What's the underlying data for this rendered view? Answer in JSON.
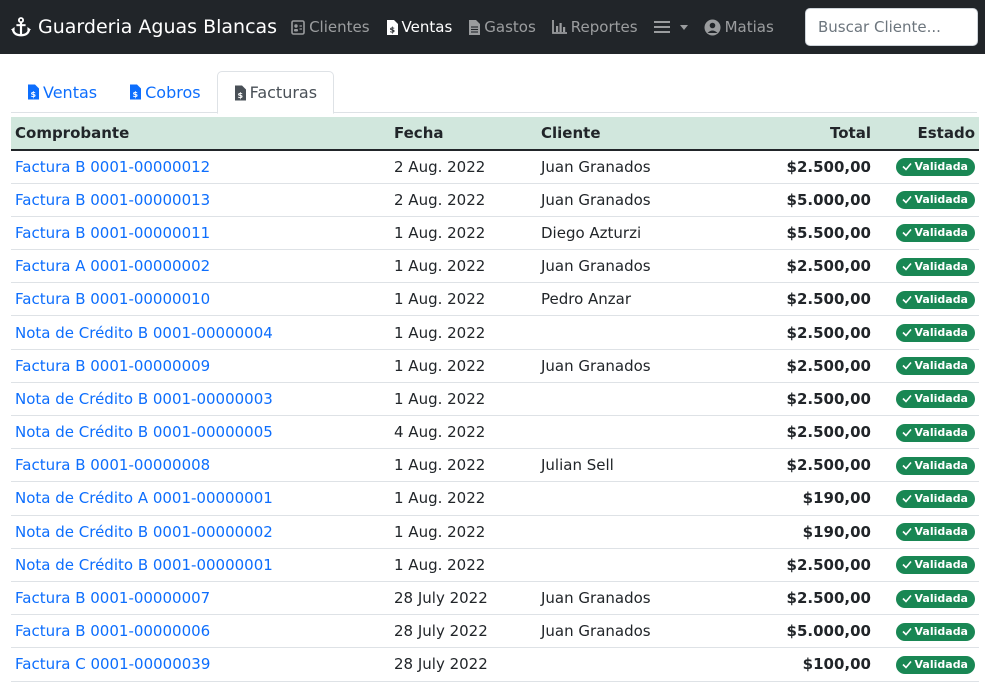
{
  "navbar": {
    "brand": "Guarderia Aguas Blancas",
    "items": [
      {
        "label": "Clientes"
      },
      {
        "label": "Ventas"
      },
      {
        "label": "Gastos"
      },
      {
        "label": "Reportes"
      }
    ],
    "user": "Matias",
    "search_placeholder": "Buscar Cliente..."
  },
  "tabs": [
    {
      "label": "Ventas"
    },
    {
      "label": "Cobros"
    },
    {
      "label": "Facturas"
    }
  ],
  "table": {
    "headers": {
      "comprobante": "Comprobante",
      "fecha": "Fecha",
      "cliente": "Cliente",
      "total": "Total",
      "estado": "Estado"
    },
    "rows": [
      {
        "comprobante": "Factura B 0001-00000012",
        "fecha": "2 Aug. 2022",
        "cliente": "Juan Granados",
        "total": "$2.500,00",
        "estado": "Validada"
      },
      {
        "comprobante": "Factura B 0001-00000013",
        "fecha": "2 Aug. 2022",
        "cliente": "Juan Granados",
        "total": "$5.000,00",
        "estado": "Validada"
      },
      {
        "comprobante": "Factura B 0001-00000011",
        "fecha": "1 Aug. 2022",
        "cliente": "Diego Azturzi",
        "total": "$5.500,00",
        "estado": "Validada"
      },
      {
        "comprobante": "Factura A 0001-00000002",
        "fecha": "1 Aug. 2022",
        "cliente": "Juan Granados",
        "total": "$2.500,00",
        "estado": "Validada"
      },
      {
        "comprobante": "Factura B 0001-00000010",
        "fecha": "1 Aug. 2022",
        "cliente": "Pedro Anzar",
        "total": "$2.500,00",
        "estado": "Validada"
      },
      {
        "comprobante": "Nota de Crédito B 0001-00000004",
        "fecha": "1 Aug. 2022",
        "cliente": "",
        "total": "$2.500,00",
        "estado": "Validada"
      },
      {
        "comprobante": "Factura B 0001-00000009",
        "fecha": "1 Aug. 2022",
        "cliente": "Juan Granados",
        "total": "$2.500,00",
        "estado": "Validada"
      },
      {
        "comprobante": "Nota de Crédito B 0001-00000003",
        "fecha": "1 Aug. 2022",
        "cliente": "",
        "total": "$2.500,00",
        "estado": "Validada"
      },
      {
        "comprobante": "Nota de Crédito B 0001-00000005",
        "fecha": "4 Aug. 2022",
        "cliente": "",
        "total": "$2.500,00",
        "estado": "Validada"
      },
      {
        "comprobante": "Factura B 0001-00000008",
        "fecha": "1 Aug. 2022",
        "cliente": "Julian Sell",
        "total": "$2.500,00",
        "estado": "Validada"
      },
      {
        "comprobante": "Nota de Crédito A 0001-00000001",
        "fecha": "1 Aug. 2022",
        "cliente": "",
        "total": "$190,00",
        "estado": "Validada"
      },
      {
        "comprobante": "Nota de Crédito B 0001-00000002",
        "fecha": "1 Aug. 2022",
        "cliente": "",
        "total": "$190,00",
        "estado": "Validada"
      },
      {
        "comprobante": "Nota de Crédito B 0001-00000001",
        "fecha": "1 Aug. 2022",
        "cliente": "",
        "total": "$2.500,00",
        "estado": "Validada"
      },
      {
        "comprobante": "Factura B 0001-00000007",
        "fecha": "28 July 2022",
        "cliente": "Juan Granados",
        "total": "$2.500,00",
        "estado": "Validada"
      },
      {
        "comprobante": "Factura B 0001-00000006",
        "fecha": "28 July 2022",
        "cliente": "Juan Granados",
        "total": "$5.000,00",
        "estado": "Validada"
      },
      {
        "comprobante": "Factura C 0001-00000039",
        "fecha": "28 July 2022",
        "cliente": "",
        "total": "$100,00",
        "estado": "Validada"
      }
    ]
  }
}
